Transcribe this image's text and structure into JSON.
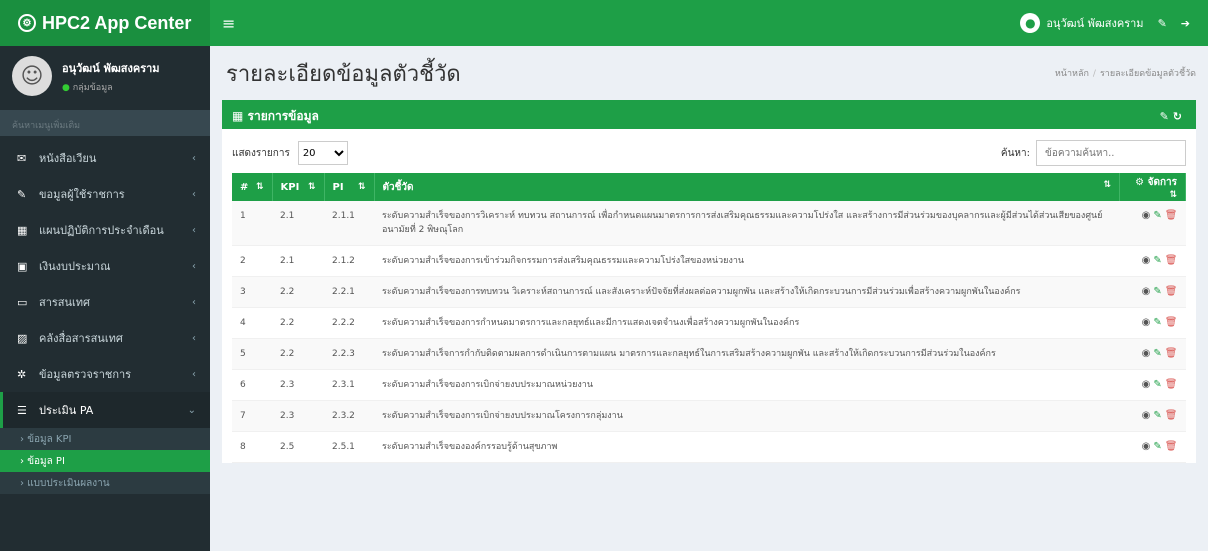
{
  "brand": {
    "title": "HPC2 App Center"
  },
  "topbar": {
    "user_name": "อนุวัฒน์ พัฒสงคราม"
  },
  "sidebar": {
    "user": {
      "name": "อนุวัฒน์ พัฒสงคราม",
      "status": "กลุ่มข้อมูล"
    },
    "search_placeholder": "ค้นหาเมนูเพิ่มเติม",
    "items": [
      {
        "label": "หนังสือเวียน"
      },
      {
        "label": "ขอมูลผู้ใช้ราชการ"
      },
      {
        "label": "แผนปฏิบัติการประจำเดือน"
      },
      {
        "label": "เงินงบประมาณ"
      },
      {
        "label": "สารสนเทศ"
      },
      {
        "label": "คลังสื่อสารสนเทศ"
      },
      {
        "label": "ข้อมูลตรวจราชการ"
      },
      {
        "label": "ประเมิน PA"
      }
    ],
    "subitems": [
      {
        "label": "ข้อมูล KPI"
      },
      {
        "label": "ข้อมูล PI"
      },
      {
        "label": "แบบประเมินผลงาน"
      }
    ]
  },
  "page": {
    "title": "รายละเอียดข้อมูลตัวชี้วัด",
    "breadcrumb_home": "หน้าหลัก",
    "breadcrumb_current": "รายละเอียดข้อมูลตัวชี้วัด"
  },
  "box": {
    "title": "รายการข้อมูล"
  },
  "controls": {
    "show_label": "แสดงรายการ",
    "page_size": "20",
    "search_label": "ค้นหา:",
    "search_placeholder": "ข้อความค้นหา.."
  },
  "table": {
    "headers": {
      "no": "#",
      "kpi": "KPI",
      "pi": "PI",
      "indicator": "ตัวชี้วัด",
      "manage": "จัดการ"
    },
    "rows": [
      {
        "no": "1",
        "kpi": "2.1",
        "pi": "2.1.1",
        "text": "ระดับความสำเร็จของการวิเคราะห์ ทบทวน สถานการณ์ เพื่อกำหนดแผนมาตรการการส่งเสริมคุณธรรมและความโปร่งใส และสร้างการมีส่วนร่วมของบุคลากรและผู้มีส่วนได้ส่วนเสียของศูนย์อนามัยที่ 2 พิษณุโลก"
      },
      {
        "no": "2",
        "kpi": "2.1",
        "pi": "2.1.2",
        "text": "ระดับความสำเร็จของการเข้าร่วมกิจกรรมการส่งเสริมคุณธรรมและความโปร่งใสของหน่วยงาน"
      },
      {
        "no": "3",
        "kpi": "2.2",
        "pi": "2.2.1",
        "text": "ระดับความสำเร็จของการทบทวน วิเคราะห์สถานการณ์ และสังเคราะห์ปัจจัยที่ส่งผลต่อความผูกพัน และสร้างให้เกิดกระบวนการมีส่วนร่วมเพื่อสร้างความผูกพันในองค์กร"
      },
      {
        "no": "4",
        "kpi": "2.2",
        "pi": "2.2.2",
        "text": "ระดับความสำเร็จของการกำหนดมาตรการและกลยุทธ์และมีการแสดงเจตจำนงเพื่อสร้างความผูกพันในองค์กร"
      },
      {
        "no": "5",
        "kpi": "2.2",
        "pi": "2.2.3",
        "text": "ระดับความสำเร็จการกำกับติดตามผลการดำเนินการตามแผน มาตรการและกลยุทธ์ในการเสริมสร้างความผูกพัน และสร้างให้เกิดกระบวนการมีส่วนร่วมในองค์กร"
      },
      {
        "no": "6",
        "kpi": "2.3",
        "pi": "2.3.1",
        "text": "ระดับความสำเร็จของการเบิกจ่ายงบประมาณหน่วยงาน"
      },
      {
        "no": "7",
        "kpi": "2.3",
        "pi": "2.3.2",
        "text": "ระดับความสำเร็จของการเบิกจ่ายงบประมาณโครงการกลุ่มงาน"
      },
      {
        "no": "8",
        "kpi": "2.5",
        "pi": "2.5.1",
        "text": "ระดับความสำเร็จขององค์กรรอบรู้ด้านสุขภาพ"
      }
    ]
  }
}
